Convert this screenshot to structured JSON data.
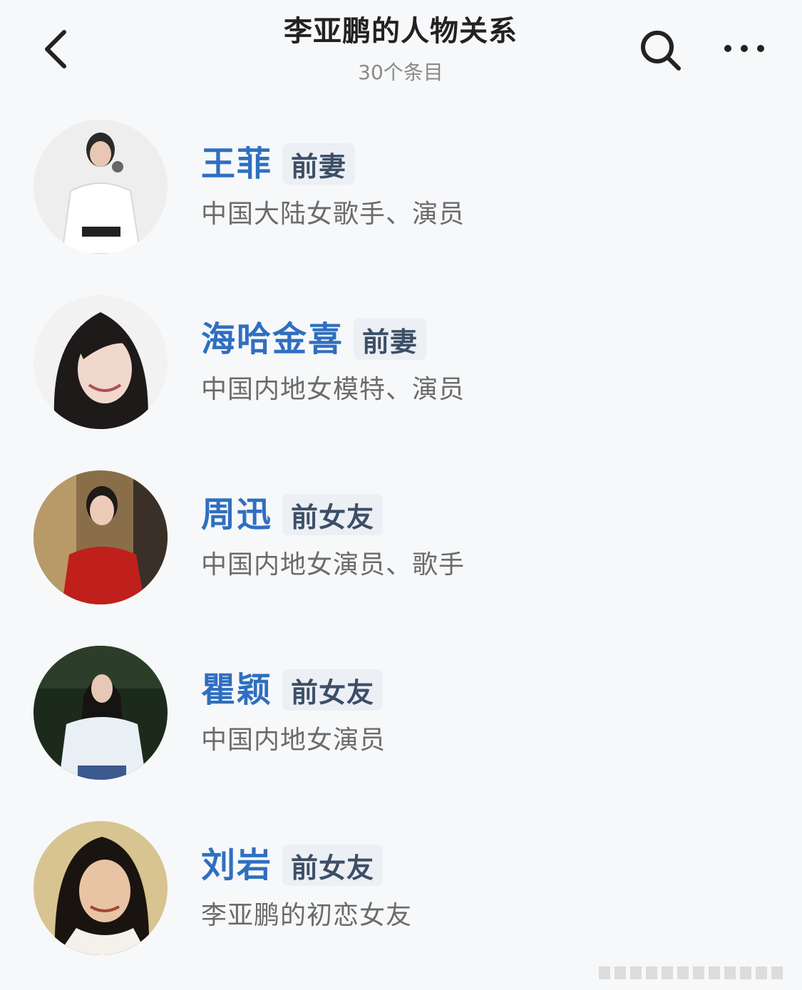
{
  "header": {
    "title": "李亚鹏的人物关系",
    "subtitle": "30个条目"
  },
  "relations": [
    {
      "name": "王菲",
      "tag": "前妻",
      "description": "中国大陆女歌手、演员"
    },
    {
      "name": "海哈金喜",
      "tag": "前妻",
      "description": "中国内地女模特、演员"
    },
    {
      "name": "周迅",
      "tag": "前女友",
      "description": "中国内地女演员、歌手"
    },
    {
      "name": "瞿颖",
      "tag": "前女友",
      "description": "中国内地女演员"
    },
    {
      "name": "刘岩",
      "tag": "前女友",
      "description": "李亚鹏的初恋女友"
    }
  ],
  "colors": {
    "name": "#2f6fc0",
    "tag_bg": "#eceff4",
    "tag_text": "#3c4f66",
    "description": "#6b6b6b",
    "background": "#f7f8fa"
  },
  "icons": {
    "back": "chevron-left-icon",
    "search": "search-icon",
    "more": "more-dots-icon"
  }
}
